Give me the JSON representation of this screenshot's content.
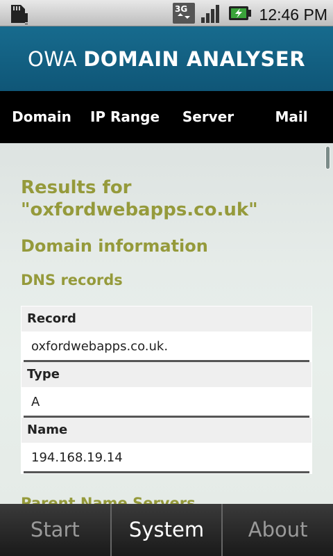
{
  "status_bar": {
    "time": "12:46 PM",
    "network": "3G",
    "icons": [
      "sd-card-icon",
      "network-3g-icon",
      "signal-icon",
      "battery-charging-icon"
    ]
  },
  "app": {
    "title_light": "OWA",
    "title_bold": "DOMAIN ANALYSER"
  },
  "nav": {
    "tabs": [
      {
        "label": "Domain"
      },
      {
        "label": "IP Range"
      },
      {
        "label": "Server"
      },
      {
        "label": "Mail"
      }
    ]
  },
  "content": {
    "results_title": "Results for \"oxfordwebapps.co.uk\"",
    "domain_info_heading": "Domain information",
    "dns_heading": "DNS records",
    "dns_records": [
      {
        "label": "Record",
        "value": "oxfordwebapps.co.uk."
      },
      {
        "label": "Type",
        "value": "A"
      },
      {
        "label": "Name",
        "value": "194.168.19.14"
      }
    ],
    "parent_ns_heading": "Parent Name Servers"
  },
  "bottom_bar": {
    "items": [
      {
        "label": "Start"
      },
      {
        "label": "System"
      },
      {
        "label": "About"
      }
    ],
    "active_index": 1
  },
  "colors": {
    "title_bar": "#176b8e",
    "heading": "#959a3b",
    "nav_bg": "#000000"
  }
}
